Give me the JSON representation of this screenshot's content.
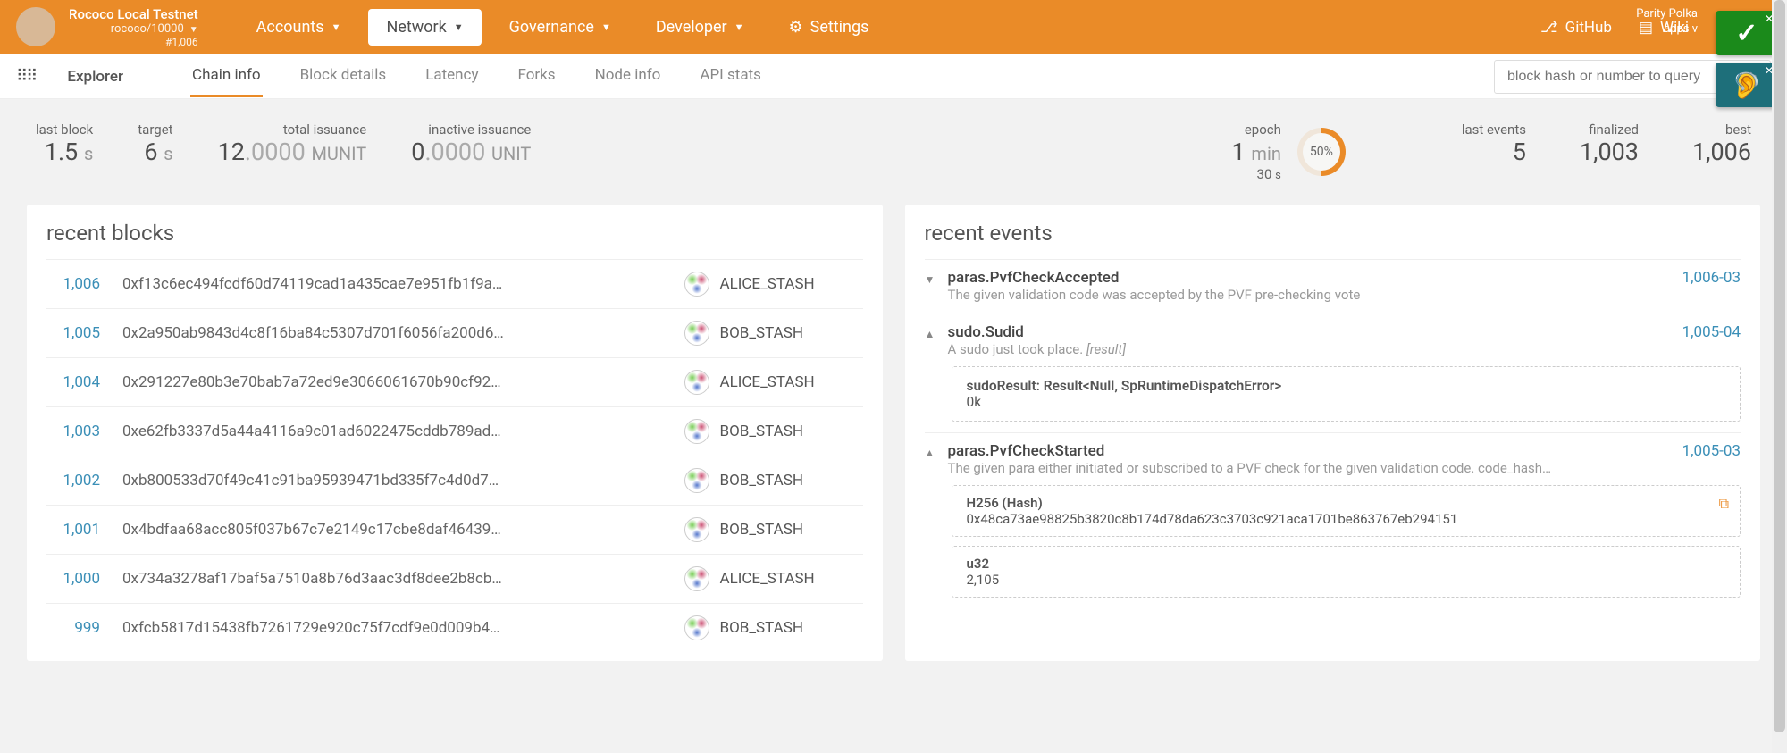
{
  "chain": {
    "name": "Rococo Local Testnet",
    "sub": "rococo/10000",
    "num": "#1,006"
  },
  "nav": {
    "accounts": "Accounts",
    "network": "Network",
    "governance": "Governance",
    "developer": "Developer",
    "settings": "Settings"
  },
  "topright": {
    "github": "GitHub",
    "wiki": "Wiki",
    "footer1": "Parity Polka",
    "footer2": "apps v"
  },
  "subbar": {
    "explorer": "Explorer",
    "chaininfo": "Chain info",
    "blockdetails": "Block details",
    "latency": "Latency",
    "forks": "Forks",
    "nodeinfo": "Node info",
    "apistats": "API stats",
    "search_ph": "block hash or number to query"
  },
  "stats": {
    "lastblock": {
      "label": "last block",
      "v": "1.5",
      "u": "s"
    },
    "target": {
      "label": "target",
      "v": "6",
      "u": "s"
    },
    "issuance": {
      "label": "total issuance",
      "v": "12",
      "dec": ".0000",
      "u": "MUNIT"
    },
    "inactive": {
      "label": "inactive issuance",
      "v": "0",
      "dec": ".0000",
      "u": "UNIT"
    },
    "epoch": {
      "label": "epoch",
      "line1": "1",
      "line1u": "min",
      "line2": "30",
      "line2u": "s",
      "pct": "50%"
    },
    "lastevents": {
      "label": "last events",
      "v": "5"
    },
    "finalized": {
      "label": "finalized",
      "v": "1,003"
    },
    "best": {
      "label": "best",
      "v": "1,006"
    }
  },
  "blocks_title": "recent blocks",
  "blocks": [
    {
      "n": "1,006",
      "h": "0xf13c6ec494fcdf60d74119cad1a435cae7e951fb1f9a…",
      "a": "ALICE_STASH"
    },
    {
      "n": "1,005",
      "h": "0x2a950ab9843d4c8f16ba84c5307d701f6056fa200d6…",
      "a": "BOB_STASH"
    },
    {
      "n": "1,004",
      "h": "0x291227e80b3e70bab7a72ed9e3066061670b90cf92…",
      "a": "ALICE_STASH"
    },
    {
      "n": "1,003",
      "h": "0xe62fb3337d5a44a4116a9c01ad6022475cddb789ad…",
      "a": "BOB_STASH"
    },
    {
      "n": "1,002",
      "h": "0xb800533d70f49c41c91ba95939471bd335f7c4d0d7…",
      "a": "BOB_STASH"
    },
    {
      "n": "1,001",
      "h": "0x4bdfaa68acc805f037b67c7e2149c17cbe8daf46439…",
      "a": "BOB_STASH"
    },
    {
      "n": "1,000",
      "h": "0x734a3278af17baf5a7510a8b76d3aac3df8dee2b8cb…",
      "a": "ALICE_STASH"
    },
    {
      "n": "999",
      "h": "0xfcb5817d15438fb7261729e920c75f7cdf9e0d009b4…",
      "a": "BOB_STASH"
    }
  ],
  "events_title": "recent events",
  "events": {
    "e0": {
      "toggle": "▼",
      "title": "paras.PvfCheckAccepted",
      "desc": "The given validation code was accepted by the PVF pre-checking vote",
      "id": "1,006-03"
    },
    "e1": {
      "toggle": "▲",
      "title": "sudo.Sudid",
      "desc": "A sudo just took place.",
      "desc_i": "[result]",
      "id": "1,005-04",
      "body_label": "sudoResult: Result<Null, SpRuntimeDispatchError>",
      "body_val": "0k"
    },
    "e2": {
      "toggle": "▲",
      "title": "paras.PvfCheckStarted",
      "desc": "The given para either initiated or subscribed to a PVF check for the given validation code. code_hash…",
      "id": "1,005-03",
      "h256_label": "H256 (Hash)",
      "h256": "0x48ca73ae98825b3820c8b174d78da623c3703c921aca1701be863767eb294151",
      "u32_label": "u32",
      "u32": "2,105"
    }
  }
}
